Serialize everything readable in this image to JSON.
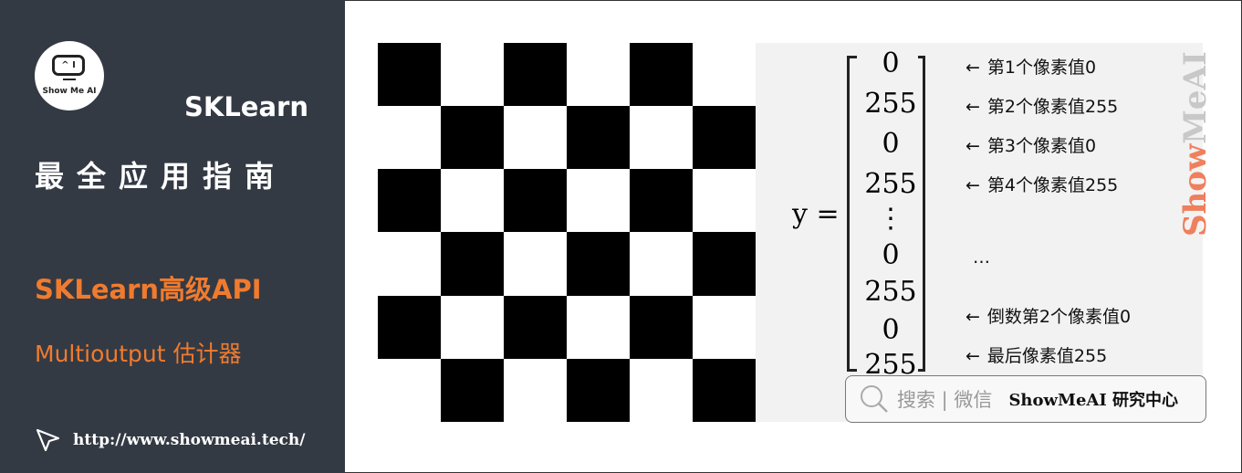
{
  "sidebar": {
    "logo_text": "Show Me AI",
    "logo_screen": "^ I",
    "title": "SKLearn",
    "subtitle": "最全应用指南",
    "section": "SKLearn高级API",
    "topic": "Multioutput 估计器",
    "url": "http://www.showmeai.tech/"
  },
  "checkerboard": {
    "rows": 6,
    "cols": 6,
    "first_cell": "black",
    "colors": {
      "black": "#000000",
      "white": "#ffffff"
    }
  },
  "formula": {
    "lhs": "y =",
    "vector": [
      "0",
      "255",
      "0",
      "255",
      "⋮",
      "0",
      "255",
      "0",
      "255"
    ],
    "annotations": [
      {
        "arrow": "←",
        "text": "第1个像素值0"
      },
      {
        "arrow": "←",
        "text": "第2个像素值255"
      },
      {
        "arrow": "←",
        "text": "第3个像素值0"
      },
      {
        "arrow": "←",
        "text": "第4个像素值255"
      },
      {
        "arrow": "",
        "text": "…"
      },
      {
        "arrow": "←",
        "text": "倒数第2个像素值0"
      },
      {
        "arrow": "←",
        "text": "最后像素值255"
      }
    ]
  },
  "watermark": {
    "part1": "Show",
    "part2": "MeAI"
  },
  "search": {
    "icon": "search-icon",
    "gray": "搜索 | 微信",
    "bold": "ShowMeAI 研究中心"
  },
  "colors": {
    "sidebar_bg": "#343a44",
    "accent": "#f07b2e"
  }
}
